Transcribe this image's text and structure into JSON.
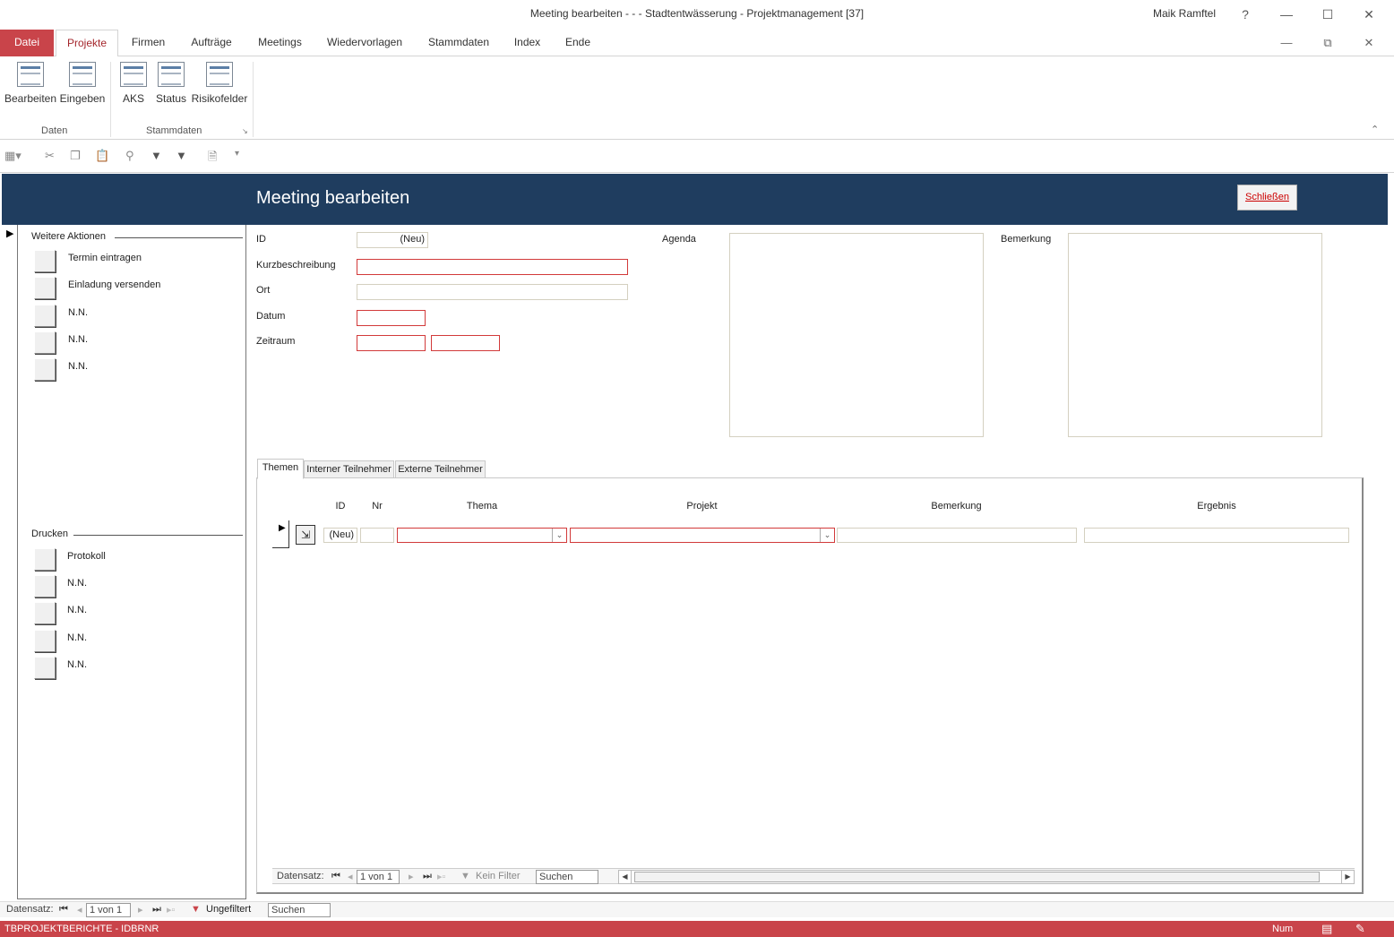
{
  "window": {
    "title": "Meeting bearbeiten -  -  - Stadtentwässerung - Projektmanagement [37]",
    "user": "Maik Ramftel",
    "help": "?"
  },
  "ribbon_tabs": [
    "Datei",
    "Projekte",
    "Firmen",
    "Aufträge",
    "Meetings",
    "Wiedervorlagen",
    "Stammdaten",
    "Index",
    "Ende"
  ],
  "ribbon": {
    "groups": [
      {
        "label": "Daten",
        "buttons": [
          "Bearbeiten",
          "Eingeben"
        ]
      },
      {
        "label": "Stammdaten",
        "buttons": [
          "AKS",
          "Status",
          "Risikofelder"
        ]
      }
    ]
  },
  "form": {
    "title": "Meeting bearbeiten",
    "close_label": "Schließen"
  },
  "left_panel": {
    "actions_title": "Weitere Aktionen",
    "actions": [
      "Termin eintragen",
      "Einladung versenden",
      "N.N.",
      "N.N.",
      "N.N."
    ],
    "print_title": "Drucken",
    "print": [
      "Protokoll",
      "N.N.",
      "N.N.",
      "N.N.",
      "N.N."
    ]
  },
  "fields": {
    "id_label": "ID",
    "id_value": "(Neu)",
    "kurz_label": "Kurzbeschreibung",
    "ort_label": "Ort",
    "datum_label": "Datum",
    "zeitraum_label": "Zeitraum",
    "agenda_label": "Agenda",
    "bemerkung_label": "Bemerkung"
  },
  "subform": {
    "tabs": [
      "Themen",
      "Interner Teilnehmer",
      "Externe Teilnehmer"
    ],
    "columns": [
      "ID",
      "Nr",
      "Thema",
      "Projekt",
      "Bemerkung",
      "Ergebnis"
    ],
    "row": {
      "id": "(Neu)"
    },
    "nav": {
      "label": "Datensatz:",
      "position": "1 von 1",
      "filter": "Kein Filter",
      "search": "Suchen"
    }
  },
  "main_nav": {
    "label": "Datensatz:",
    "position": "1 von 1",
    "filter": "Ungefiltert",
    "search": "Suchen"
  },
  "status": {
    "left": "TBPROJEKTBERICHTE - IDBRNR",
    "right": "Num"
  }
}
